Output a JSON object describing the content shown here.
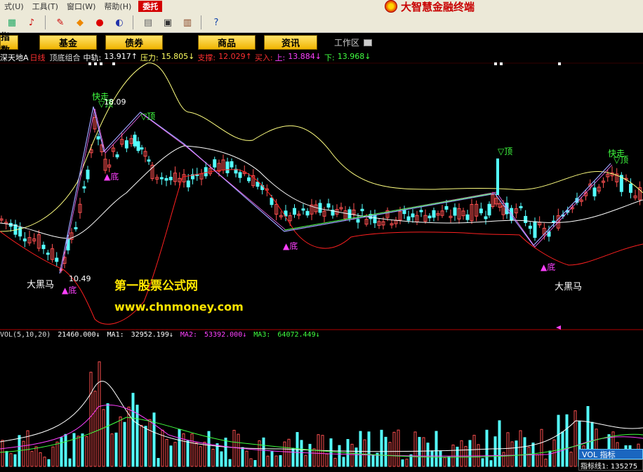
{
  "menu": {
    "items": [
      "式(U)",
      "工具(T)",
      "窗口(W)",
      "帮助(H)",
      "委托"
    ],
    "active_index": 4
  },
  "brand": {
    "title": "大智慧金融终端"
  },
  "toolbar": {
    "icons": [
      "stock-icon",
      "alert-icon",
      "pencil-icon",
      "diamond-icon",
      "lock-icon",
      "swirl-icon",
      "copy-icon",
      "window-icon",
      "books-icon",
      "help-icon"
    ]
  },
  "tabs": [
    "指数",
    "基金",
    "债券",
    "商品",
    "资讯"
  ],
  "workspace": {
    "label": "工作区"
  },
  "info": {
    "stock": "深天地A",
    "period": "日线",
    "indicator": "顶底组合",
    "mid_label": "中轨:",
    "mid_value": "13.917↑",
    "pressure_label": "压力:",
    "pressure_value": "15.805↓",
    "support_label": "支撑:",
    "support_value": "12.029↑",
    "buy_label": "买入:",
    "up_label": "上:",
    "up_value": "13.884↓",
    "down_label": "下:",
    "down_value": "13.968↓"
  },
  "annotations": {
    "kuaizou": "快走",
    "top": "▽顶",
    "bottom": "▲底",
    "heima": "大黑马",
    "high_price": "18.09",
    "low_price": "10.49"
  },
  "watermark": {
    "line1": "第一股票公式网",
    "line2": "www.chnmoney.com"
  },
  "vol": {
    "name": "VOL(5,10,20)",
    "vol_value": "21460.000↓",
    "ma1_label": "MA1:",
    "ma1_value": "32952.199↓",
    "ma2_label": "MA2:",
    "ma2_value": "53392.000↓",
    "ma3_label": "MA3:",
    "ma3_value": "64072.449↓"
  },
  "vol_panel": {
    "header": "VOL 指标",
    "row": "指标线1: 135275"
  },
  "colors": {
    "up": "#ff5050",
    "down": "#54ffff",
    "mid": "#ffffff",
    "pressure": "#ffff80",
    "support": "#ff2020",
    "green": "#40ff40",
    "magenta": "#ff40ff"
  }
}
